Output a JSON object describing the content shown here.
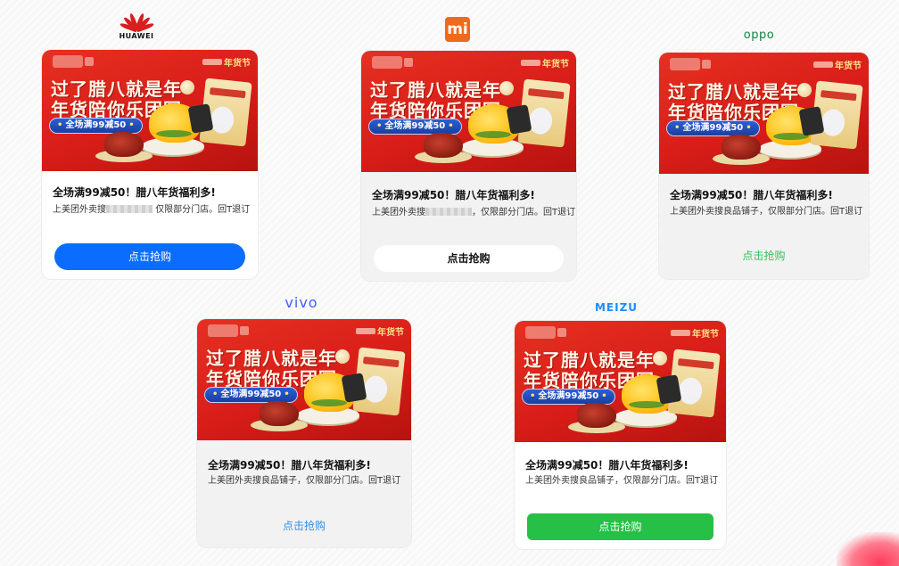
{
  "brands": {
    "huawei": {
      "name": "HUAWEI",
      "icon": "huawei-petal-icon",
      "color": "#d81e1e"
    },
    "xiaomi": {
      "name": "mi",
      "icon": "xiaomi-mi-icon",
      "color": "#f2691a"
    },
    "oppo": {
      "name": "oppo",
      "icon": "oppo-wordmark",
      "color": "#128243"
    },
    "vivo": {
      "name": "vivo",
      "icon": "vivo-wordmark",
      "color": "#415fff"
    },
    "meizu": {
      "name": "MEIZU",
      "icon": "meizu-wordmark",
      "color": "#1e8bff"
    }
  },
  "banner": {
    "line1": "过了腊八就是年",
    "line2": "年货陪你乐团圆",
    "pill": "全场满99减50",
    "corner_text": "年货节"
  },
  "cards": {
    "huawei": {
      "title": "全场满99减50！腊八年货福利多!",
      "desc_prefix": "上美团外卖搜",
      "desc_suffix": "仅限部分门店。回T退订",
      "button": "点击抢购",
      "button_color": "#0a6dff"
    },
    "xiaomi": {
      "title": "全场满99减50！腊八年货福利多!",
      "desc_prefix": "上美团外卖搜",
      "desc_suffix": "，仅限部分门店。回T退订",
      "button": "点击抢购",
      "button_color": "#ffffff"
    },
    "oppo": {
      "title": "全场满99减50！腊八年货福利多!",
      "desc": "上美团外卖搜良品铺子，仅限部分门店。回T退订",
      "button": "点击抢购",
      "button_color": "#33c15c"
    },
    "vivo": {
      "title": "全场满99减50！腊八年货福利多!",
      "desc": "上美团外卖搜良品铺子，仅限部分门店。回T退订",
      "button": "点击抢购",
      "button_color": "#3a8ee6"
    },
    "meizu": {
      "title": "全场满99减50！腊八年货福利多!",
      "desc": "上美团外卖搜良品铺子，仅限部分门店。回T退订",
      "button": "点击抢购",
      "button_color": "#27c047"
    }
  }
}
